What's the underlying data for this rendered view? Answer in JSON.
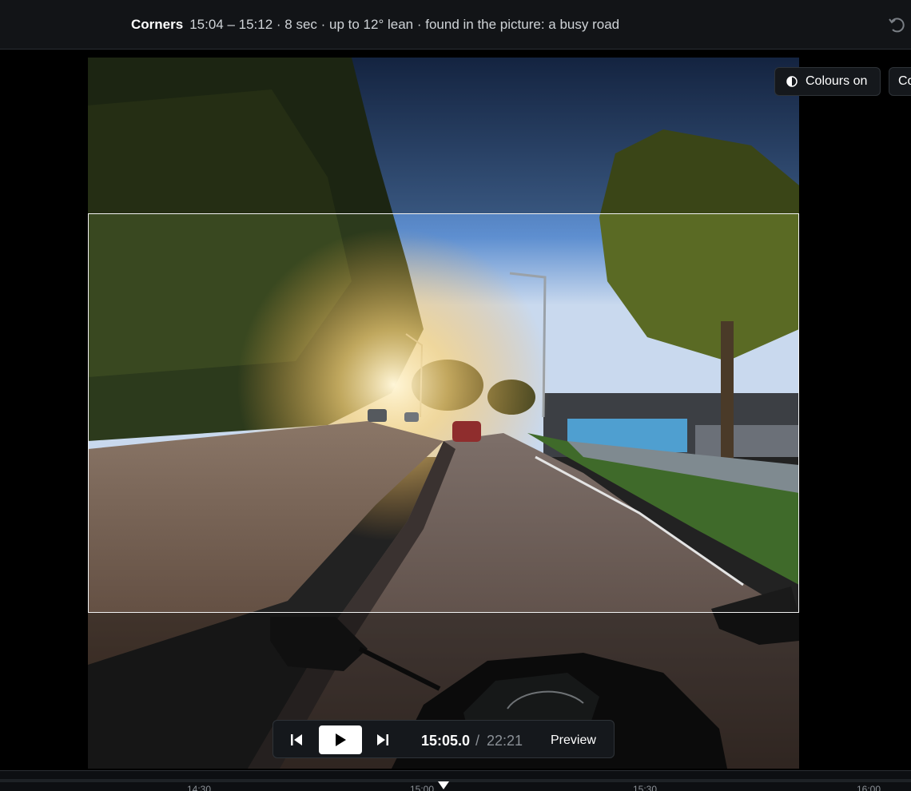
{
  "header": {
    "title": "Corners",
    "meta": "15:04 – 15:12 · 8 sec · up to 12° lean · found in the picture: a busy road"
  },
  "toggles": {
    "colours_label": "Colours on",
    "second_label": "Co"
  },
  "player": {
    "current_time": "15:05.0",
    "separator": "/",
    "total_time": "22:21",
    "preview_label": "Preview"
  },
  "timeline": {
    "ticks": [
      "14:30",
      "15:00",
      "15:30",
      "16:00"
    ]
  },
  "icons": {
    "undo": "undo-icon",
    "contrast": "contrast-icon",
    "prev": "skip-back-icon",
    "play": "play-icon",
    "next": "skip-forward-icon"
  },
  "colors": {
    "accent": "#ffffff",
    "panel": "#15181c"
  }
}
